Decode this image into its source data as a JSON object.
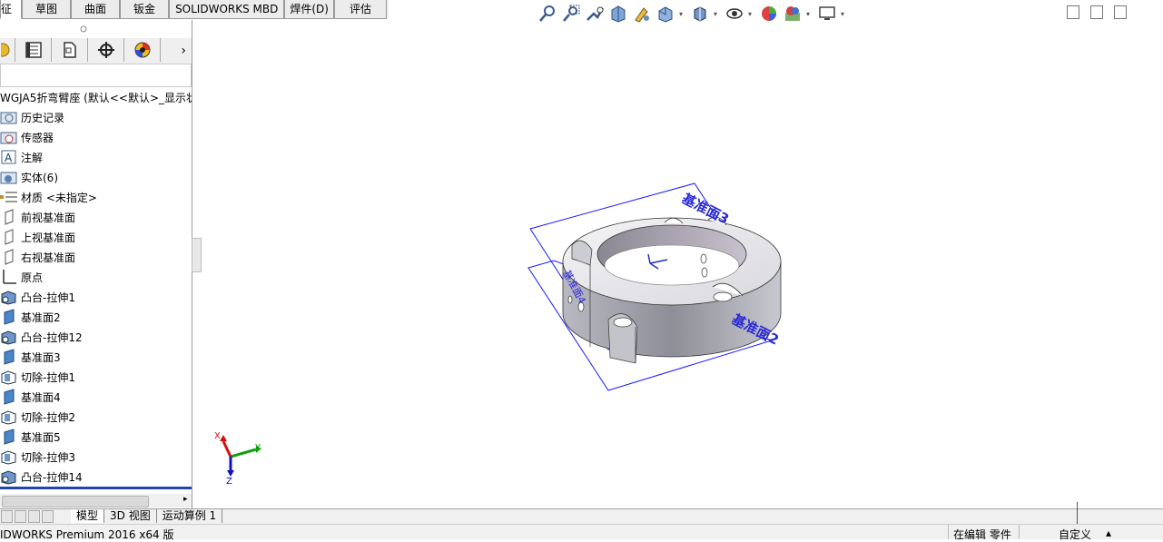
{
  "command_tabs": [
    {
      "label": "征",
      "active": true
    },
    {
      "label": "草图",
      "active": false
    },
    {
      "label": "曲面",
      "active": false
    },
    {
      "label": "钣金",
      "active": false
    },
    {
      "label": "SOLIDWORKS MBD",
      "active": false
    },
    {
      "label": "焊件(D)",
      "active": false
    },
    {
      "label": "评估",
      "active": false
    }
  ],
  "heads_up_toolbar": {
    "icons": [
      "zoom-to-fit-icon",
      "zoom-to-area-icon",
      "previous-view-icon",
      "section-view-icon",
      "dynamic-annotation-icon",
      "view-orientation-icon",
      "display-style-icon",
      "hide-show-items-icon",
      "edit-appearance-icon",
      "apply-scene-icon",
      "view-settings-icon"
    ]
  },
  "manager_tabs": [
    "feature-manager-icon",
    "property-manager-icon",
    "configuration-manager-icon",
    "dimxpert-manager-icon",
    "display-manager-icon"
  ],
  "tree": {
    "root": "WGJA5折弯臂座  (默认<<默认>_显示状",
    "items": [
      {
        "label": "历史记录",
        "icon": "history-folder-icon"
      },
      {
        "label": "传感器",
        "icon": "sensor-icon"
      },
      {
        "label": "注解",
        "icon": "annotation-icon"
      },
      {
        "label": "实体(6)",
        "icon": "solid-bodies-icon"
      },
      {
        "label": "材质 <未指定>",
        "icon": "material-icon"
      },
      {
        "label": "前视基准面",
        "icon": "plane-icon"
      },
      {
        "label": "上视基准面",
        "icon": "plane-icon"
      },
      {
        "label": "右视基准面",
        "icon": "plane-icon"
      },
      {
        "label": "原点",
        "icon": "origin-icon"
      },
      {
        "label": "凸台-拉伸1",
        "icon": "boss-extrude-icon"
      },
      {
        "label": "基准面2",
        "icon": "ref-plane-icon"
      },
      {
        "label": "凸台-拉伸12",
        "icon": "boss-extrude-icon"
      },
      {
        "label": "基准面3",
        "icon": "ref-plane-icon"
      },
      {
        "label": "切除-拉伸1",
        "icon": "cut-extrude-icon"
      },
      {
        "label": "基准面4",
        "icon": "ref-plane-icon"
      },
      {
        "label": "切除-拉伸2",
        "icon": "cut-extrude-icon"
      },
      {
        "label": "基准面5",
        "icon": "ref-plane-icon"
      },
      {
        "label": "切除-拉伸3",
        "icon": "cut-extrude-icon"
      },
      {
        "label": "凸台-拉伸14",
        "icon": "boss-extrude-icon"
      }
    ]
  },
  "viewport": {
    "plane_labels": [
      "基准面3",
      "基准面2",
      "基准面4"
    ],
    "triad_labels": {
      "x": "X",
      "y": "Y",
      "z": "Z"
    },
    "colors": {
      "plane": "#1a1aff",
      "body": "#9a9aa6",
      "x_axis": "#d01010",
      "y_axis": "#10a010",
      "z_axis": "#1010c0"
    }
  },
  "bottom_tabs": [
    {
      "label": "模型",
      "active": true
    },
    {
      "label": "3D 视图",
      "active": false
    },
    {
      "label": "运动算例 1",
      "active": false
    }
  ],
  "status_bar": {
    "product": "IDWORKS Premium 2016 x64 版",
    "mode": "在编辑 零件",
    "units": "自定义"
  }
}
